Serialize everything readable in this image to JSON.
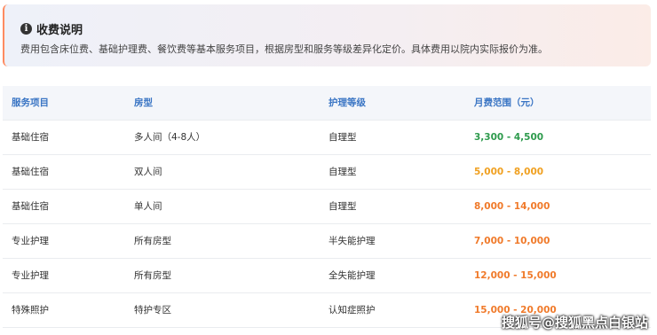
{
  "notice": {
    "icon": "info-icon",
    "title": "收费说明",
    "text": "费用包含床位费、基础护理费、餐饮费等基本服务项目，根据房型和服务等级差异化定价。具体费用以院内实际报价为准。"
  },
  "table": {
    "headers": [
      "服务项目",
      "房型",
      "护理等级",
      "月费范围（元）"
    ],
    "rows": [
      {
        "service": "基础住宿",
        "room": "多人间（4-8人）",
        "level": "自理型",
        "price": "3,300 - 4,500",
        "color": "#2e9b4d"
      },
      {
        "service": "基础住宿",
        "room": "双人间",
        "level": "自理型",
        "price": "5,000 - 8,000",
        "color": "#f0a020"
      },
      {
        "service": "基础住宿",
        "room": "单人间",
        "level": "自理型",
        "price": "8,000 - 14,000",
        "color": "#f07a2a"
      },
      {
        "service": "专业护理",
        "room": "所有房型",
        "level": "半失能护理",
        "price": "7,000 - 10,000",
        "color": "#f07a2a"
      },
      {
        "service": "专业护理",
        "room": "所有房型",
        "level": "全失能护理",
        "price": "12,000 - 15,000",
        "color": "#f07a2a"
      },
      {
        "service": "特殊照护",
        "room": "特护专区",
        "level": "认知症照护",
        "price": "15,000 - 20,000",
        "color": "#f07a2a"
      }
    ]
  },
  "watermark": "搜狐号@搜狐黑点白银站"
}
